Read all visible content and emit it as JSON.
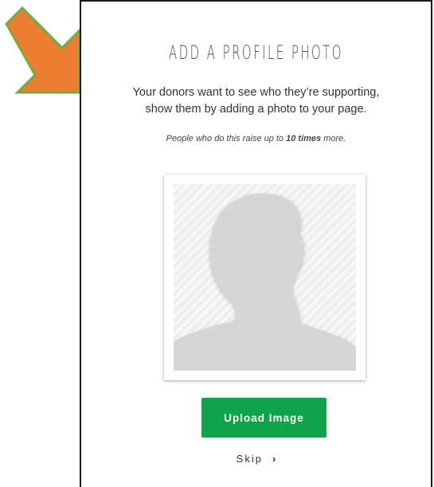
{
  "modal": {
    "title": "ADD A PROFILE PHOTO",
    "subtitle_line1": "Your donors want to see who they’re supporting,",
    "subtitle_line2": "show them by adding a photo to your page.",
    "stat_prefix": "People who do this raise up to ",
    "stat_emphasis": "10 times",
    "stat_suffix": " more.",
    "upload_label": "Upload Image",
    "skip_label": "Skip",
    "skip_icon": "chevron-right-icon",
    "placeholder_icon": "person-silhouette-icon"
  },
  "annotation": {
    "icon": "arrow-down-right-icon",
    "fill_color": "#ed7d31",
    "stroke_color": "#70ad47"
  },
  "colors": {
    "button": "#0fa34a",
    "text": "#333333",
    "border": "#1a1a1a"
  }
}
